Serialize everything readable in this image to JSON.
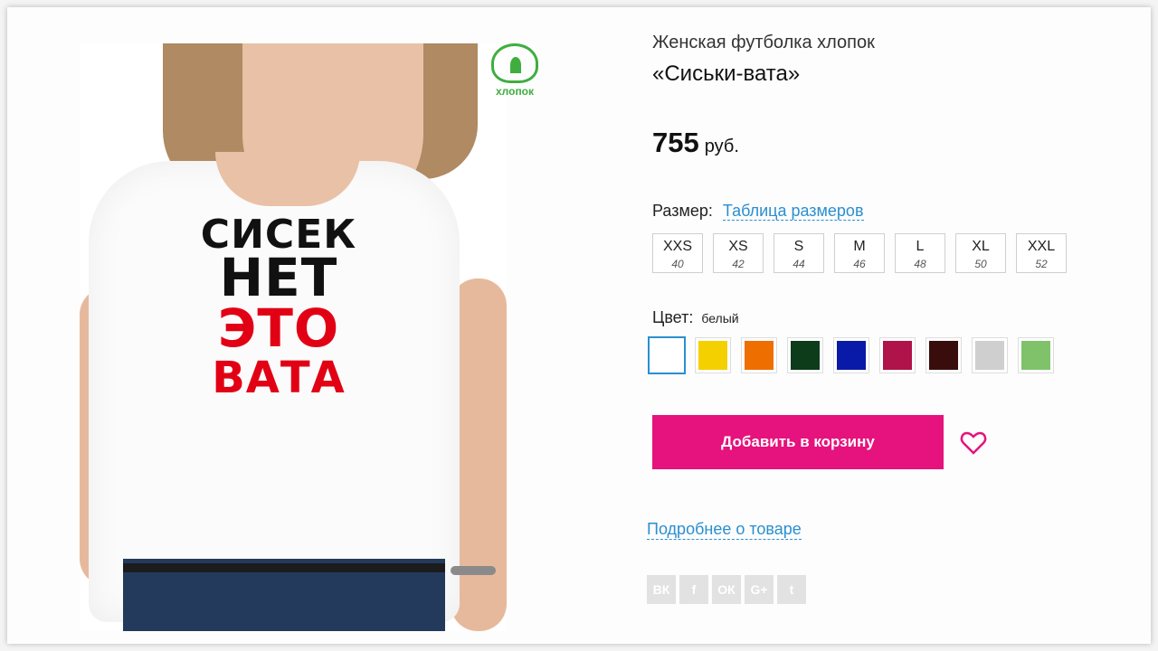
{
  "product": {
    "title_line1": "Женская футболка хлопок",
    "title_line2": "«Сиськи-вата»",
    "price_value": "755",
    "price_currency": "руб.",
    "print_lines": [
      "СИСЕК",
      "НЕТ",
      "ЭТО",
      "ВАТА"
    ],
    "badge_label": "хлопок"
  },
  "size": {
    "label": "Размер:",
    "chart_link": "Таблица размеров",
    "options": [
      {
        "size": "XXS",
        "num": "40"
      },
      {
        "size": "XS",
        "num": "42"
      },
      {
        "size": "S",
        "num": "44"
      },
      {
        "size": "M",
        "num": "46"
      },
      {
        "size": "L",
        "num": "48"
      },
      {
        "size": "XL",
        "num": "50"
      },
      {
        "size": "XXL",
        "num": "52"
      }
    ]
  },
  "color": {
    "label": "Цвет:",
    "selected": "белый",
    "swatches": [
      "#ffffff",
      "#f5d000",
      "#ee6e00",
      "#0c3c1a",
      "#0a1aa8",
      "#b0124a",
      "#3a0d0d",
      "#cfcfcf",
      "#7fc26a"
    ]
  },
  "actions": {
    "add_to_cart": "Добавить в корзину",
    "more_link": "Подробнее о товаре"
  },
  "social": [
    "ВК",
    "f",
    "ОК",
    "G+",
    "t"
  ],
  "colors": {
    "accent": "#e6127d",
    "link": "#2a8fd0",
    "badge": "#3fae3f"
  }
}
